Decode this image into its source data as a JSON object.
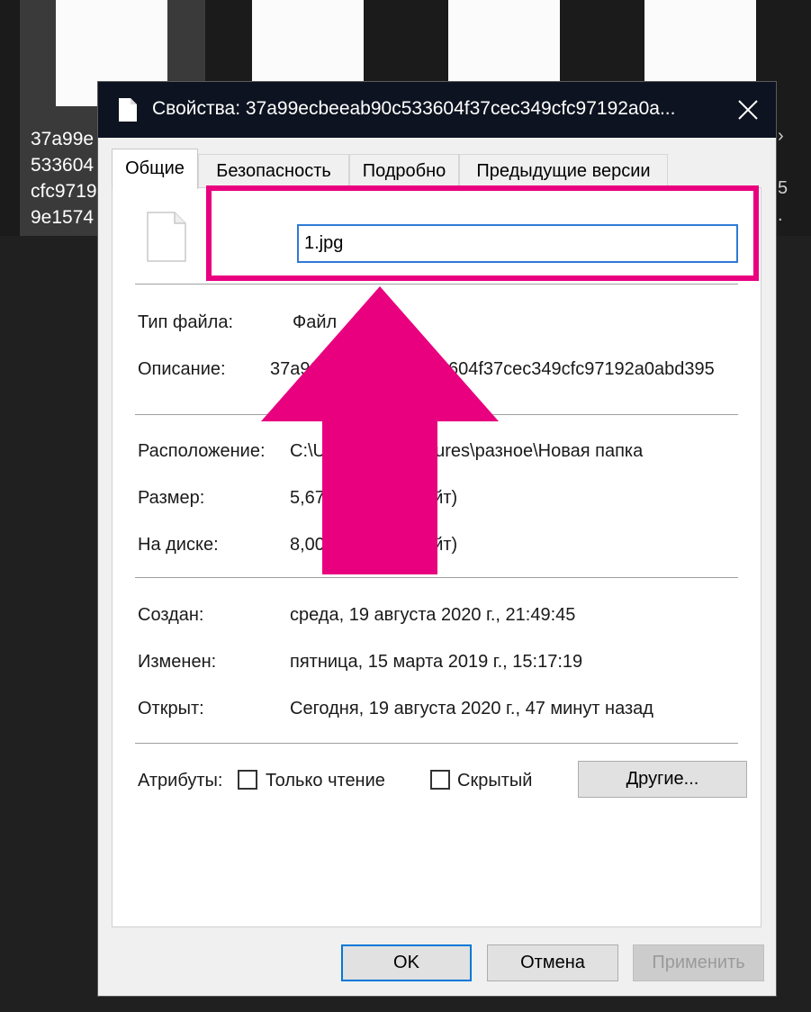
{
  "background": {
    "file_label_lines": [
      "37a99e",
      "533604",
      "cfc9719",
      "9e1574"
    ],
    "edge_chars": [
      "›",
      "",
      "5",
      "."
    ]
  },
  "dialog": {
    "title": "Свойства: 37a99ecbeeab90c533604f37cec349cfc97192a0a...",
    "tabs": [
      {
        "label": "Общие",
        "active": true
      },
      {
        "label": "Безопасность",
        "active": false
      },
      {
        "label": "Подробно",
        "active": false
      },
      {
        "label": "Предыдущие версии",
        "active": false
      }
    ],
    "general": {
      "file_name": "1.jpg",
      "file_type_label": "Тип файла:",
      "file_type_value": "Файл",
      "description_label": "Описание:",
      "description_value": "37a99ecbeeab90c533604f37cec349cfc97192a0abd395",
      "location_label": "Расположение:",
      "location_value": "C:\\Users\\user\\Pictures\\разное\\Новая папка",
      "size_label": "Размер:",
      "size_value": "5,67 КБ (5 810 байт)",
      "disk_label": "На диске:",
      "disk_value": "8,00 КБ (8 192 байт)",
      "created_label": "Создан:",
      "created_value": "среда, 19 августа 2020 г., 21:49:45",
      "modified_label": "Изменен:",
      "modified_value": "пятница, 15 марта 2019 г., 15:17:19",
      "opened_label": "Открыт:",
      "opened_value": "Сегодня, 19 августа 2020 г., 47 минут назад",
      "attributes_label": "Атрибуты:",
      "readonly_label": "Только чтение",
      "readonly_checked": false,
      "hidden_label": "Скрытый",
      "hidden_checked": false,
      "other_button": "Другие..."
    },
    "buttons": {
      "ok": "OK",
      "cancel": "Отмена",
      "apply": "Применить"
    }
  },
  "annotation": {
    "color": "#e8007f"
  }
}
